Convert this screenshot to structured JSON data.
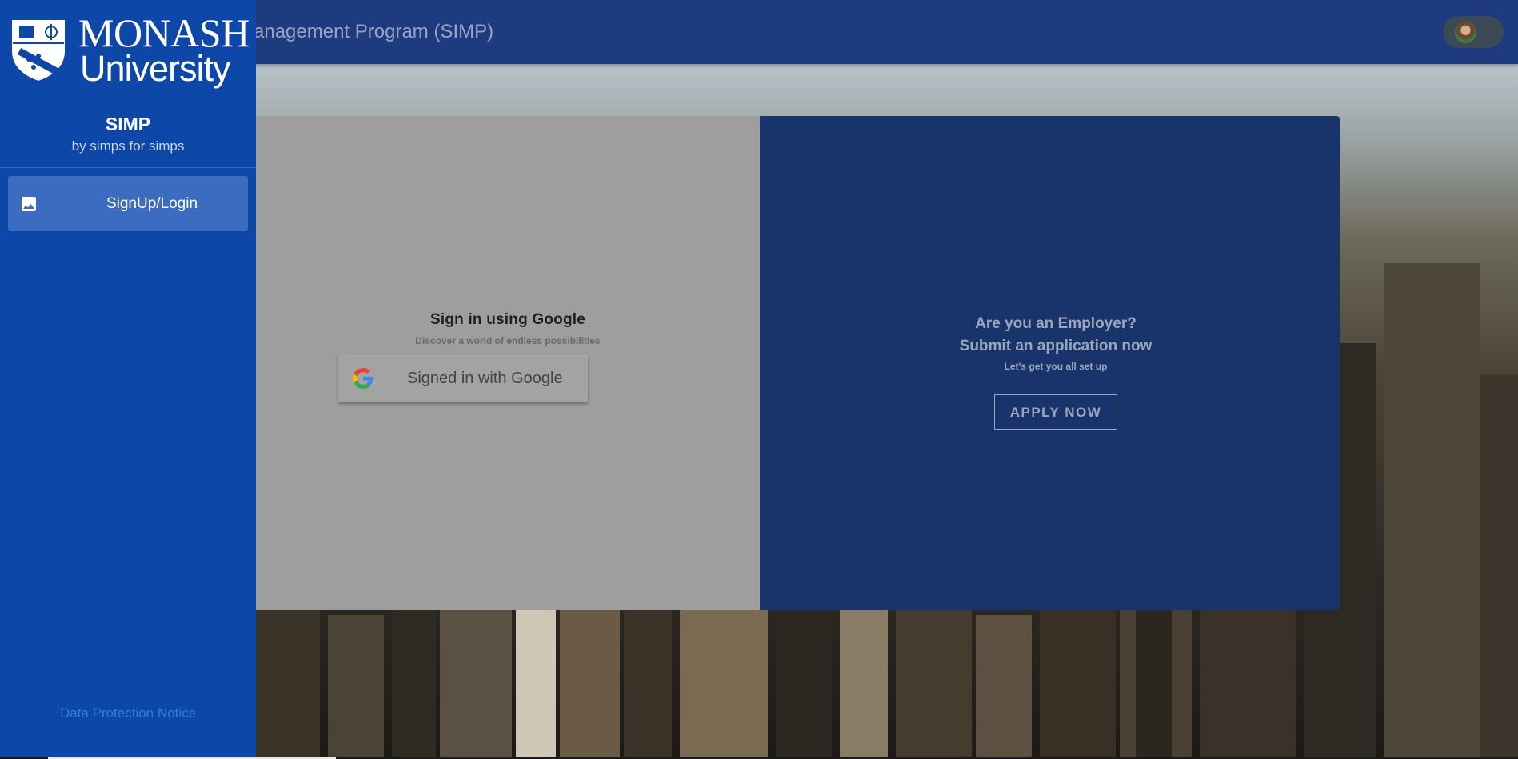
{
  "topbar": {
    "title": "anagement Program (SIMP)"
  },
  "user": {
    "avatar_icon": "user-avatar"
  },
  "sidebar": {
    "logo_name": "MONASH",
    "logo_sub": "University",
    "app_title": "SIMP",
    "app_subtitle": "by simps for simps",
    "items": [
      {
        "label": "SignUp/Login",
        "icon": "image-icon"
      }
    ],
    "footer_link": "Data Protection Notice"
  },
  "signin": {
    "title": "Sign in using Google",
    "subtitle": "Discover a world of endless possibilities",
    "button_label": "Signed in with Google"
  },
  "employer": {
    "line1": "Are you an Employer?",
    "line2": "Submit an application now",
    "subtitle": "Let's get you all set up",
    "button_label": "APPLY NOW"
  },
  "colors": {
    "sidebar": "#0d47a8",
    "topbar": "#1d3b7e",
    "panel_dark": "#19346b",
    "nav_active": "#3c6cc0",
    "link": "#2f7fd9"
  }
}
